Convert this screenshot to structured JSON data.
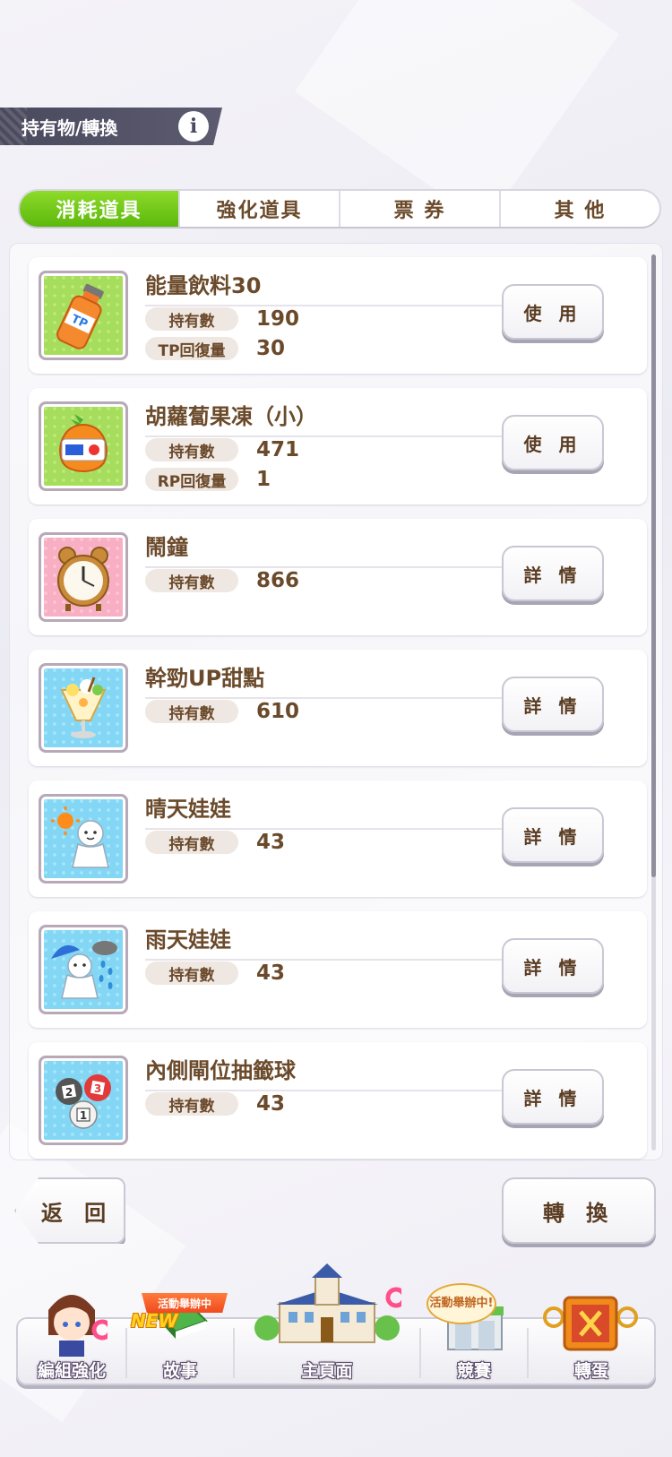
{
  "header": {
    "title": "持有物/轉換",
    "info_icon": "info-icon"
  },
  "tabs": [
    {
      "label": "消耗道具",
      "active": true
    },
    {
      "label": "強化道具",
      "active": false
    },
    {
      "label": "票 券",
      "active": false
    },
    {
      "label": "其 他",
      "active": false
    }
  ],
  "items": [
    {
      "name": "能量飲料30",
      "icon": "energy-drink-icon",
      "stats": [
        {
          "label": "持有數",
          "value": "190"
        },
        {
          "label": "TP回復量",
          "value": "30"
        }
      ],
      "button": "使 用"
    },
    {
      "name": "胡蘿蔔果凍（小）",
      "icon": "carrot-jelly-icon",
      "stats": [
        {
          "label": "持有數",
          "value": "471"
        },
        {
          "label": "RP回復量",
          "value": "1"
        }
      ],
      "button": "使 用"
    },
    {
      "name": "鬧鐘",
      "icon": "alarm-clock-icon",
      "stats": [
        {
          "label": "持有數",
          "value": "866"
        }
      ],
      "button": "詳 情"
    },
    {
      "name": "幹勁UP甜點",
      "icon": "parfait-icon",
      "stats": [
        {
          "label": "持有數",
          "value": "610"
        }
      ],
      "button": "詳 情"
    },
    {
      "name": "晴天娃娃",
      "icon": "sunny-doll-icon",
      "stats": [
        {
          "label": "持有數",
          "value": "43"
        }
      ],
      "button": "詳 情"
    },
    {
      "name": "雨天娃娃",
      "icon": "rainy-doll-icon",
      "stats": [
        {
          "label": "持有數",
          "value": "43"
        }
      ],
      "button": "詳 情"
    },
    {
      "name": "內側閘位抽籤球",
      "icon": "lottery-ball-icon",
      "stats": [
        {
          "label": "持有數",
          "value": "43"
        }
      ],
      "button": "詳 情"
    }
  ],
  "footer": {
    "back_label": "返 回",
    "convert_label": "轉 換"
  },
  "nav": {
    "items": [
      {
        "label": "編組強化"
      },
      {
        "label": "故事"
      },
      {
        "label": "主頁面"
      },
      {
        "label": "競賽"
      },
      {
        "label": "轉蛋"
      }
    ],
    "event_ribbon": "活動舉辦中",
    "new_tag": "NEW",
    "event_bubble": "活動舉辦中!"
  }
}
